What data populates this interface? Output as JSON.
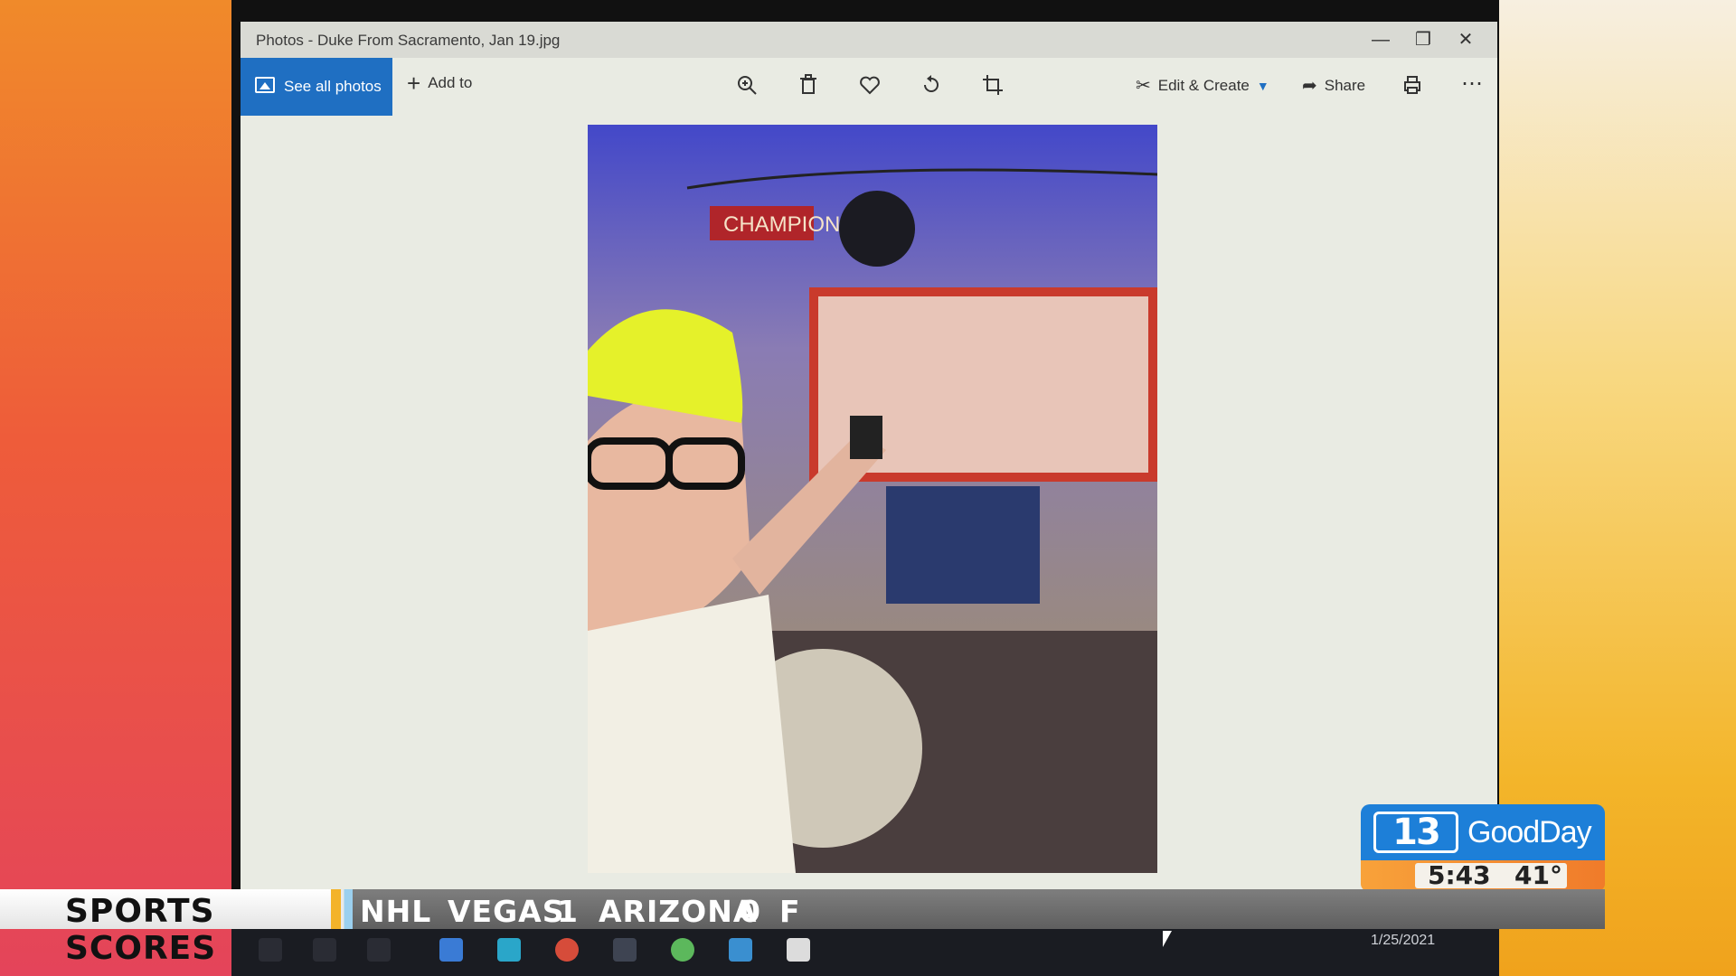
{
  "window": {
    "title": "Photos - Duke From Sacramento, Jan 19.jpg",
    "minimize_icon": "minimize-icon",
    "restore_icon": "restore-icon",
    "close_icon": "close-icon"
  },
  "toolbar": {
    "see_all_label": "See all photos",
    "add_to_label": "Add to",
    "icons": [
      "zoom-icon",
      "delete-icon",
      "favorite-icon",
      "rotate-icon",
      "crop-icon"
    ],
    "edit_create_label": "Edit & Create",
    "share_label": "Share",
    "print_icon": "print-icon",
    "more_icon": "more-icon"
  },
  "photo": {
    "sign_text": "CHAMPION"
  },
  "taskbar": {
    "date": "1/25/2021"
  },
  "station_bug": {
    "channel": "13",
    "show": "GoodDay",
    "time": "5:43",
    "temperature": "41°",
    "brand_color": "#1d7fd8",
    "accent_color": "#f07b2a"
  },
  "ticker": {
    "label": "SPORTS SCORES",
    "league": "NHL",
    "team1": "VEGAS",
    "score1": "1",
    "team2": "ARIZONA",
    "score2": "0",
    "status": "F"
  }
}
